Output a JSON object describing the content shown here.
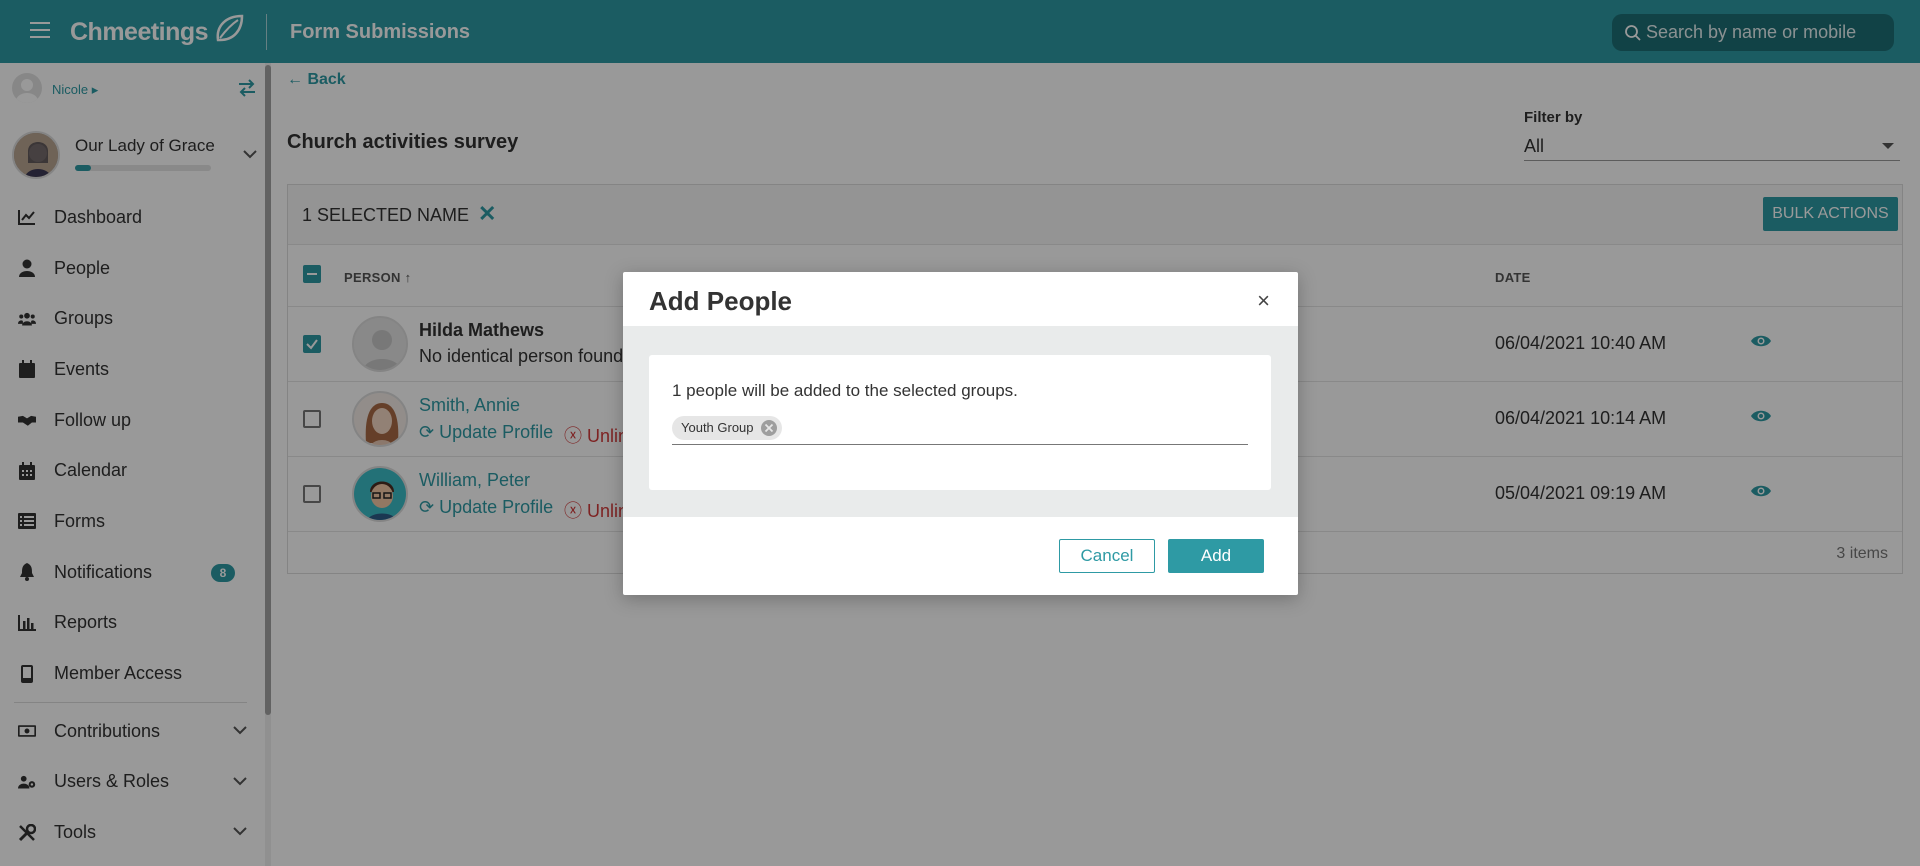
{
  "app": {
    "brand": "Chmeetings",
    "page_title": "Form Submissions",
    "accent_color": "#2e9aa4"
  },
  "search": {
    "placeholder": "Search by name or mobile"
  },
  "sidebar": {
    "user_name": "Nicole",
    "church_name": "Our Lady of Grace",
    "church_progress": 0.12,
    "items": [
      {
        "label": "Dashboard",
        "icon": "chart-line-icon"
      },
      {
        "label": "People",
        "icon": "user-icon"
      },
      {
        "label": "Groups",
        "icon": "users-icon"
      },
      {
        "label": "Events",
        "icon": "calendar-solid-icon"
      },
      {
        "label": "Follow up",
        "icon": "handshake-icon"
      },
      {
        "label": "Calendar",
        "icon": "calendar-icon"
      },
      {
        "label": "Forms",
        "icon": "list-icon"
      },
      {
        "label": "Notifications",
        "icon": "bell-icon",
        "badge": "8"
      },
      {
        "label": "Reports",
        "icon": "bar-chart-icon"
      },
      {
        "label": "Member Access",
        "icon": "mobile-icon"
      },
      {
        "label": "Contributions",
        "icon": "money-icon"
      },
      {
        "label": "Users & Roles",
        "icon": "users-cog-icon"
      },
      {
        "label": "Tools",
        "icon": "tools-icon"
      }
    ]
  },
  "main": {
    "back_label": "Back",
    "survey_title": "Church activities survey",
    "filter_label": "Filter by",
    "filter_value": "All",
    "selected_label": "1 SELECTED NAME",
    "bulk_actions_label": "BULK ACTIONS",
    "columns": {
      "person": "PERSON",
      "date": "DATE"
    },
    "rows": [
      {
        "name": "Hilda Mathews",
        "sub": "No identical person found",
        "date": "06/04/2021 10:40 AM",
        "checked": true,
        "kind": "new"
      },
      {
        "name": "Smith, Annie",
        "update": "Update Profile",
        "unlink": "Unlin",
        "date": "06/04/2021 10:14 AM",
        "checked": false,
        "kind": "linked"
      },
      {
        "name": "William, Peter",
        "update": "Update Profile",
        "unlink": "Unlin",
        "date": "05/04/2021 09:19 AM",
        "checked": false,
        "kind": "linked"
      }
    ],
    "items_count": "3 items"
  },
  "modal": {
    "title": "Add People",
    "close_label": "×",
    "message": "1 people will be added to the selected groups.",
    "chip_label": "Youth Group",
    "cancel_label": "Cancel",
    "add_label": "Add"
  }
}
